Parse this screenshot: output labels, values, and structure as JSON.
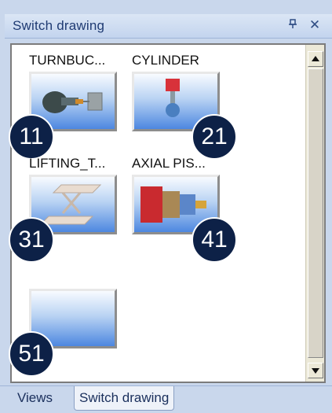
{
  "panel": {
    "title": "Switch drawing",
    "pin_glyph": "⊣",
    "close_glyph": "✕"
  },
  "items": [
    {
      "label": "TURNBUC...",
      "number": "11",
      "icon": "turnbuckle-part-icon"
    },
    {
      "label": "CYLINDER",
      "number": "21",
      "icon": "cylinder-part-icon"
    },
    {
      "label": "LIFTING_T...",
      "number": "31",
      "icon": "lifting-table-part-icon"
    },
    {
      "label": "AXIAL PIS...",
      "number": "41",
      "icon": "axial-piston-part-icon"
    },
    {
      "label": "",
      "number": "51",
      "icon": "empty-drawing-icon"
    }
  ],
  "tabs": [
    {
      "label": "Views",
      "active": false
    },
    {
      "label": "Switch drawing",
      "active": true
    }
  ],
  "colors": {
    "badge": "#0d2147",
    "title": "#1f3b73",
    "thumb_gradient_bottom": "#4d87e0"
  }
}
